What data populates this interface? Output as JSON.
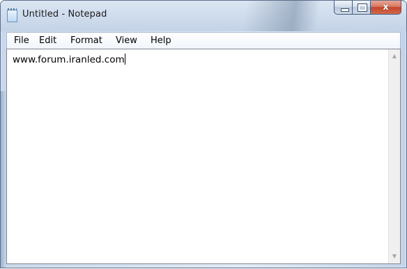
{
  "window": {
    "title": "Untitled - Notepad"
  },
  "caption_buttons": {
    "minimize_icon": "minimize-icon",
    "maximize_icon": "maximize-icon",
    "close_icon": "close-icon",
    "close_glyph": "x"
  },
  "menu": {
    "items": [
      "File",
      "Edit",
      "Format",
      "View",
      "Help"
    ]
  },
  "editor": {
    "text": "www.forum.iranled.com"
  },
  "scrollbar": {
    "up_glyph": "▲",
    "down_glyph": "▼"
  },
  "colors": {
    "title_bar": "#cfdced",
    "close_button": "#c2452a",
    "editor_background": "#ffffff"
  }
}
